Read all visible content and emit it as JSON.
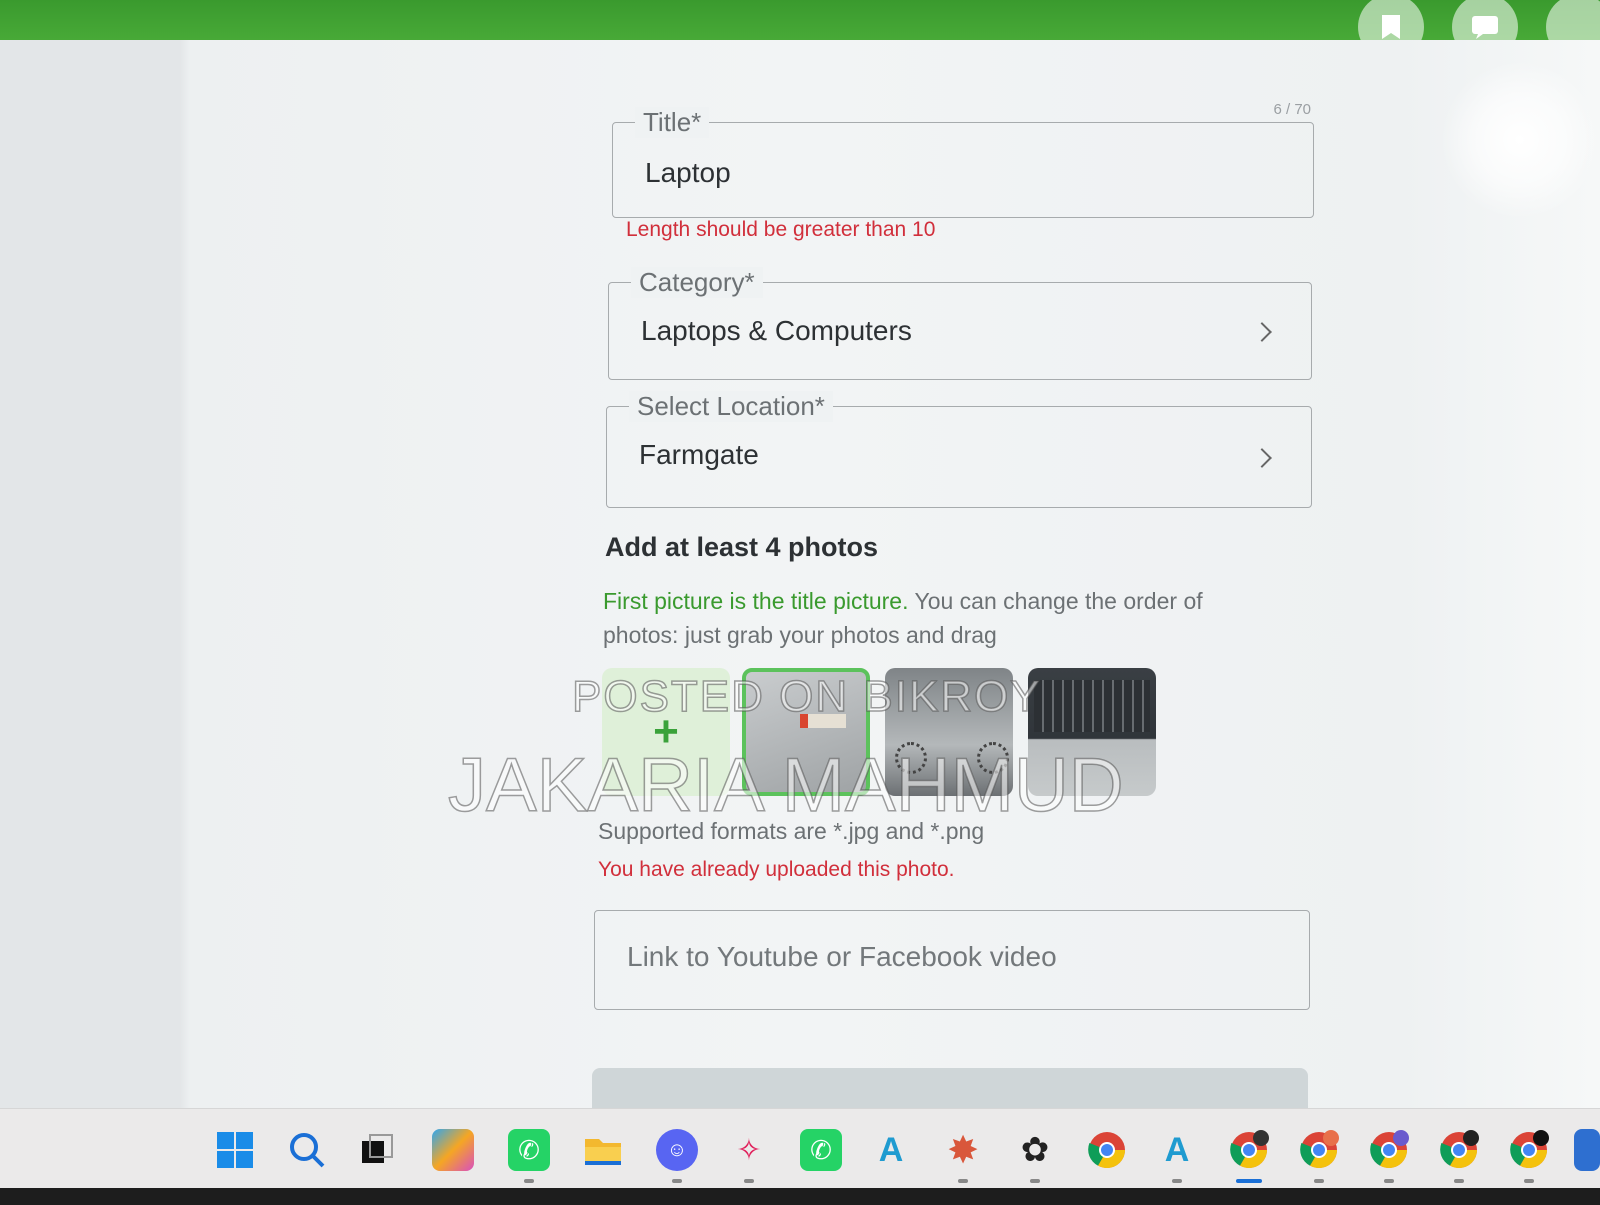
{
  "form": {
    "title": {
      "label": "Title*",
      "value": "Laptop",
      "counter": "6 / 70",
      "error": "Length should be greater than 10"
    },
    "category": {
      "label": "Category*",
      "value": "Laptops & Computers"
    },
    "location": {
      "label": "Select Location*",
      "value": "Farmgate"
    },
    "photos": {
      "heading": "Add at least 4 photos",
      "help_green": "First picture is the title picture.",
      "help_rest": " You can change the order of photos: just grab your photos and drag",
      "add_symbol": "+",
      "formats": "Supported formats are *.jpg and *.png",
      "error": "You have already uploaded this photo."
    },
    "video": {
      "placeholder": "Link to Youtube or Facebook video"
    }
  },
  "watermark": {
    "line1": "POSTED ON BIKROY",
    "line2": "JAKARIA MAHMUD"
  },
  "taskbar": {
    "icons": [
      "windows-start-icon",
      "search-icon",
      "task-view-icon",
      "copilot-icon",
      "whatsapp-icon",
      "file-explorer-icon",
      "discord-icon",
      "slack-icon",
      "whatsapp-business-icon",
      "app-icon",
      "claude-icon",
      "chatgpt-icon",
      "chrome-icon",
      "app-icon-2",
      "chrome-profile-icon-1",
      "chrome-profile-icon-2",
      "chrome-profile-icon-3",
      "chrome-profile-icon-4",
      "chrome-profile-icon-5"
    ]
  },
  "colors": {
    "brand_green": "#4cae3a",
    "error_red": "#d12f3b"
  }
}
